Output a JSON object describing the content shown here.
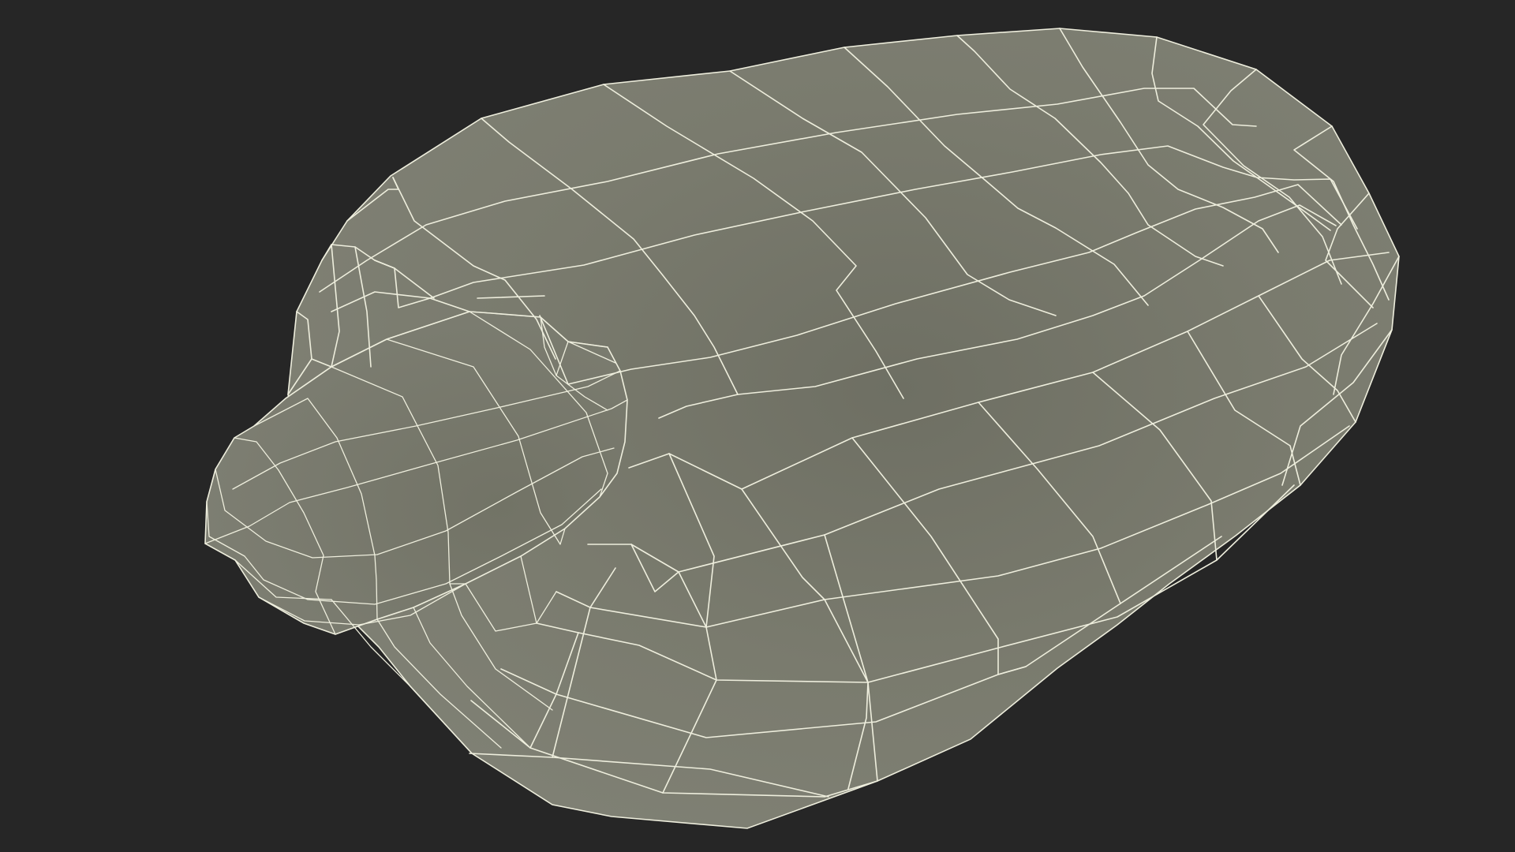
{
  "viewport": {
    "background_color": "#262626"
  },
  "model": {
    "surface_color": "#7a7b6e",
    "surface_shadow_color": "#676859",
    "surface_highlight_color": "#84857a",
    "wire_color": "#eeeedd"
  }
}
